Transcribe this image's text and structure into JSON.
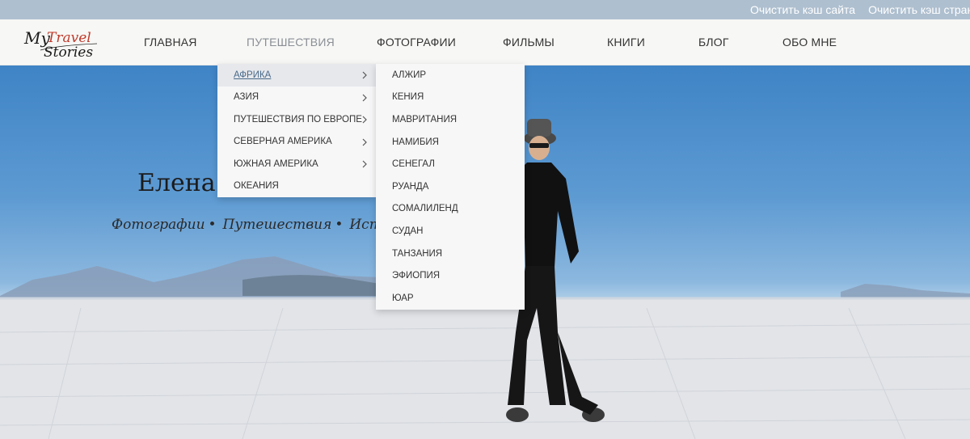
{
  "adminbar": {
    "links": [
      "Очистить кэш сайта",
      "Очистить кэш страни"
    ]
  },
  "logo": {
    "line1": "My",
    "line2": "Travel",
    "line3": "Stories"
  },
  "nav": {
    "items": [
      "ГЛАВНАЯ",
      "ПУТЕШЕСТВИЯ",
      "ФОТОГРАФИИ",
      "ФИЛЬМЫ",
      "КНИГИ",
      "БЛОГ",
      "ОБО МНЕ"
    ],
    "active": "ПУТЕШЕСТВИЯ"
  },
  "hero": {
    "title": "Елена П",
    "subtitle": [
      "Фотографии",
      "Путешествия",
      "Истори"
    ],
    "separator": "•"
  },
  "menu_travel": {
    "items": [
      {
        "label": "АФРИКА",
        "has_submenu": true,
        "active": true
      },
      {
        "label": "АЗИЯ",
        "has_submenu": true
      },
      {
        "label": "ПУТЕШЕСТВИЯ ПО ЕВРОПЕ",
        "has_submenu": true
      },
      {
        "label": "СЕВЕРНАЯ АМЕРИКА",
        "has_submenu": true
      },
      {
        "label": "ЮЖНАЯ АМЕРИКА",
        "has_submenu": true
      },
      {
        "label": "ОКЕАНИЯ",
        "has_submenu": false
      }
    ],
    "arrow_icon": "chevron-right-icon"
  },
  "menu_africa": {
    "items": [
      "АЛЖИР",
      "КЕНИЯ",
      "МАВРИТАНИЯ",
      "НАМИБИЯ",
      "СЕНЕГАЛ",
      "РУАНДА",
      "СОМАЛИЛЕНД",
      "СУДАН",
      "ТАНЗАНИЯ",
      "ЭФИОПИЯ",
      "ЮАР"
    ]
  },
  "colors": {
    "logo_red": "#c0392b",
    "nav_active": "#8a8f96",
    "adminbar": "#aebfcf"
  }
}
